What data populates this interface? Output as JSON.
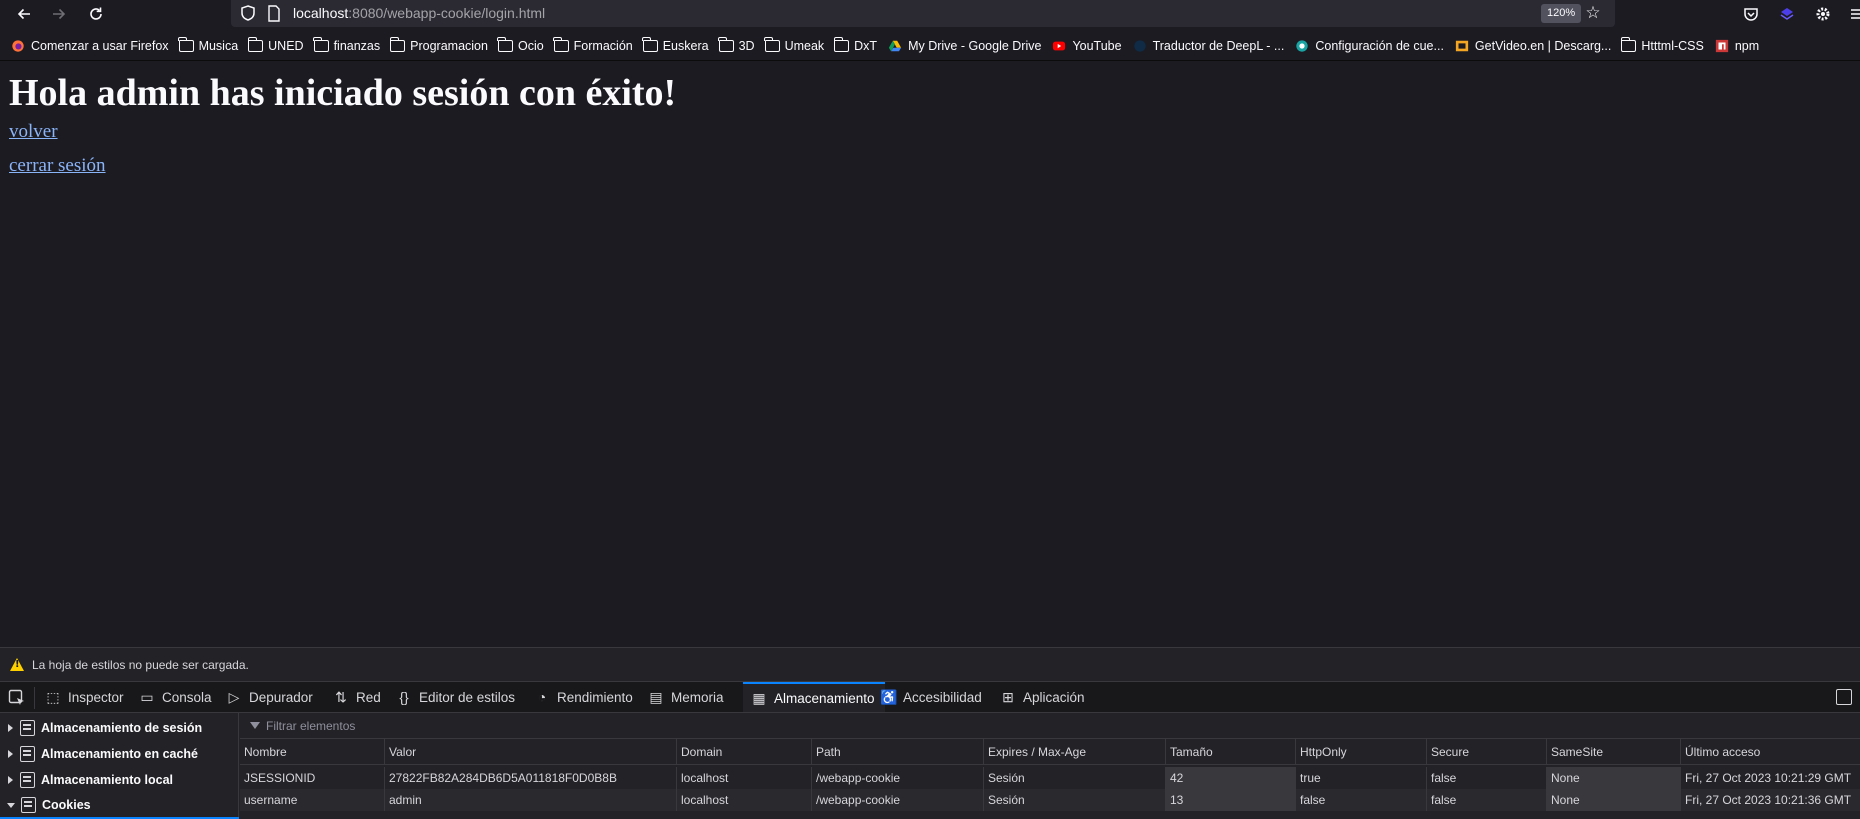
{
  "url": {
    "host": "localhost",
    "rest": ":8080/webapp-cookie/login.html",
    "zoom": "120%"
  },
  "bookmarks": [
    {
      "label": "Comenzar a usar Firefox",
      "icon": "firefox-icon"
    },
    {
      "label": "Musica",
      "icon": "folder-icon"
    },
    {
      "label": "UNED",
      "icon": "folder-icon"
    },
    {
      "label": "finanzas",
      "icon": "folder-icon"
    },
    {
      "label": "Programacion",
      "icon": "folder-icon"
    },
    {
      "label": "Ocio",
      "icon": "folder-icon"
    },
    {
      "label": "Formación",
      "icon": "folder-icon"
    },
    {
      "label": "Euskera",
      "icon": "folder-icon"
    },
    {
      "label": "3D",
      "icon": "folder-icon"
    },
    {
      "label": "Umeak",
      "icon": "folder-icon"
    },
    {
      "label": "DxT",
      "icon": "folder-icon"
    },
    {
      "label": "My Drive - Google Drive",
      "icon": "google-drive-icon"
    },
    {
      "label": "YouTube",
      "icon": "youtube-icon"
    },
    {
      "label": "Traductor de DeepL - ...",
      "icon": "deepl-icon"
    },
    {
      "label": "Configuración de cue...",
      "icon": "settings-site-icon"
    },
    {
      "label": "GetVideo.en | Descarg...",
      "icon": "getvideo-icon"
    },
    {
      "label": "Htttml-CSS",
      "icon": "folder-icon"
    },
    {
      "label": "npm",
      "icon": "npm-icon"
    }
  ],
  "page": {
    "heading": "Hola admin has iniciado sesión con éxito!",
    "link_back": "volver",
    "link_logout": "cerrar sesión"
  },
  "devtools": {
    "warning": "La hoja de estilos no puede ser cargada.",
    "tabs": [
      {
        "label": "Inspector",
        "icon": "inspector-icon"
      },
      {
        "label": "Consola",
        "icon": "console-icon"
      },
      {
        "label": "Depurador",
        "icon": "debugger-icon"
      },
      {
        "label": "Red",
        "icon": "network-icon"
      },
      {
        "label": "Editor de estilos",
        "icon": "style-editor-icon"
      },
      {
        "label": "Rendimiento",
        "icon": "performance-icon"
      },
      {
        "label": "Memoria",
        "icon": "memory-icon"
      },
      {
        "label": "Almacenamiento",
        "icon": "storage-icon"
      },
      {
        "label": "Accesibilidad",
        "icon": "accessibility-icon"
      },
      {
        "label": "Aplicación",
        "icon": "application-icon"
      }
    ],
    "active_tab": "Almacenamiento",
    "sidebar": [
      {
        "label": "Almacenamiento de sesión",
        "expanded": false
      },
      {
        "label": "Almacenamiento en caché",
        "expanded": false
      },
      {
        "label": "Almacenamiento local",
        "expanded": false
      },
      {
        "label": "Cookies",
        "expanded": true
      }
    ],
    "filter_placeholder": "Filtrar elementos",
    "columns": [
      "Nombre",
      "Valor",
      "Domain",
      "Path",
      "Expires / Max-Age",
      "Tamaño",
      "HttpOnly",
      "Secure",
      "SameSite",
      "Último acceso"
    ],
    "rows": [
      [
        "JSESSIONID",
        "27822FB82A284DB6D5A011818F0D0B8B",
        "localhost",
        "/webapp-cookie",
        "Sesión",
        "42",
        "true",
        "false",
        "None",
        "Fri, 27 Oct 2023 10:21:29 GMT"
      ],
      [
        "username",
        "admin",
        "localhost",
        "/webapp-cookie",
        "Sesión",
        "13",
        "false",
        "false",
        "None",
        "Fri, 27 Oct 2023 10:21:36 GMT"
      ]
    ]
  },
  "colors": {
    "accent": "#0a84ff",
    "link": "#8ab4f8",
    "warning": "#ffd000",
    "background": "#1c1b22"
  }
}
